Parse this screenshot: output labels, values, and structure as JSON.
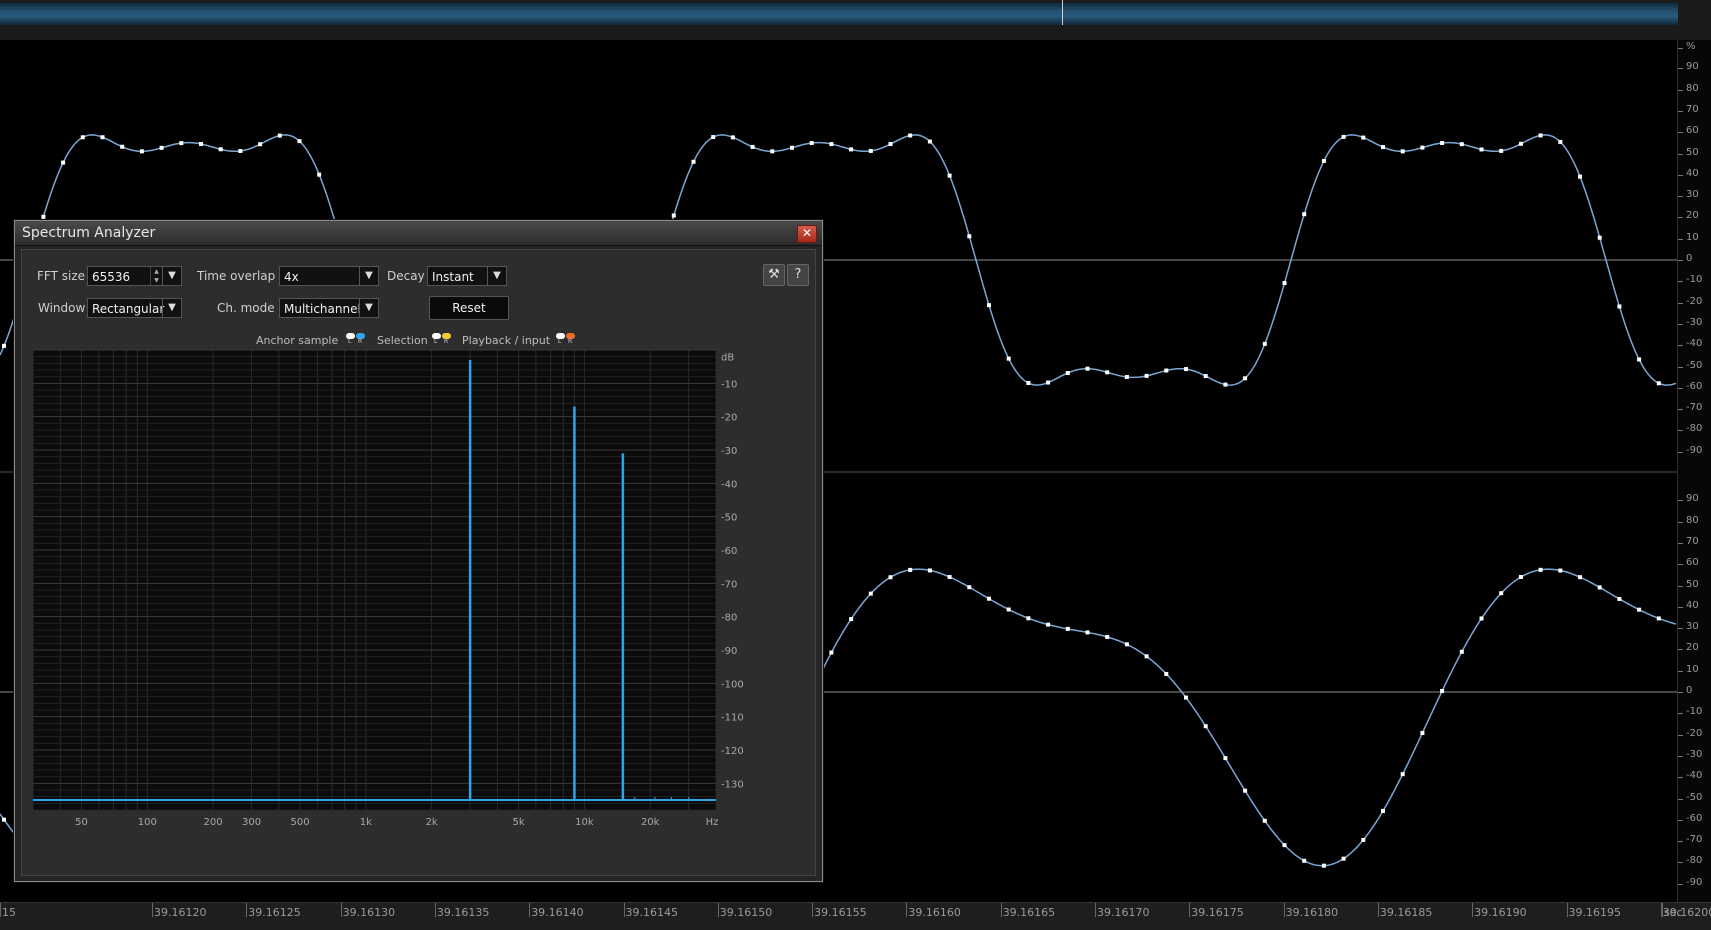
{
  "waveform": {
    "time_labels": [
      "15",
      "39.16120",
      "39.16125",
      "39.16130",
      "39.16135",
      "39.16140",
      "39.16145",
      "39.16150",
      "39.16155",
      "39.16160",
      "39.16165",
      "39.16170",
      "39.16175",
      "39.16180",
      "39.16185",
      "39.16190",
      "39.16195",
      "39.16200",
      "sec"
    ],
    "upper_scale": [
      "%",
      "90",
      "80",
      "70",
      "60",
      "50",
      "40",
      "30",
      "20",
      "10",
      "0",
      "-10",
      "-20",
      "-30",
      "-40",
      "-50",
      "-60",
      "-70",
      "-80",
      "-90"
    ],
    "lower_scale": [
      "90",
      "80",
      "70",
      "60",
      "50",
      "40",
      "30",
      "20",
      "10",
      "0",
      "-10",
      "-20",
      "-30",
      "-40",
      "-50",
      "-60",
      "-70",
      "-80",
      "-90"
    ],
    "channel_1_amplitude_percent": 60,
    "channel_2_peak_percent": 83,
    "colors": {
      "wave": "#7aa7d4",
      "sample": "#ffffff",
      "axis": "#8a8a8a"
    }
  },
  "spectrum_analyzer": {
    "title": "Spectrum Analyzer",
    "close_icon": "close-icon",
    "fft_size_label": "FFT size",
    "fft_size_value": "65536",
    "time_overlap_label": "Time overlap",
    "time_overlap_value": "4x",
    "decay_label": "Decay",
    "decay_value": "Instant",
    "window_label": "Window",
    "window_value": "Rectangular",
    "ch_mode_label": "Ch. mode",
    "ch_mode_value": "Multichannel",
    "reset_label": "Reset",
    "settings_icon": "wrench-icon",
    "help_icon": "help-icon",
    "legend": {
      "anchor_label": "Anchor sample",
      "selection_label": "Selection",
      "playback_label": "Playback / input",
      "l": "L",
      "r": "R",
      "anchor_colors": [
        "#ffffff",
        "#2fa4e7"
      ],
      "selection_colors": [
        "#ffffff",
        "#f2c83c"
      ],
      "playback_colors": [
        "#ffffff",
        "#ef6a2a"
      ]
    }
  },
  "chart_data": {
    "type": "line",
    "x_scale": "log",
    "x_unit": "Hz",
    "y_unit": "dB",
    "x_ticks": [
      "50",
      "100",
      "200",
      "300",
      "500",
      "1k",
      "2k",
      "5k",
      "10k",
      "20k",
      "Hz"
    ],
    "y_ticks": [
      "dB",
      "-10",
      "-20",
      "-30",
      "-40",
      "-50",
      "-60",
      "-70",
      "-80",
      "-90",
      "-100",
      "-110",
      "-120",
      "-130"
    ],
    "xlim": [
      30,
      40000
    ],
    "ylim": [
      -138,
      0
    ],
    "peaks": [
      {
        "freq_hz": 3000,
        "db": -3
      },
      {
        "freq_hz": 9000,
        "db": -17
      },
      {
        "freq_hz": 15000,
        "db": -31
      }
    ],
    "noise_floor_db": -135,
    "grid": true,
    "color": "#2fa4e7"
  }
}
